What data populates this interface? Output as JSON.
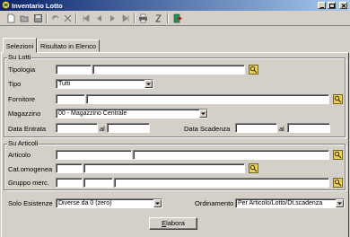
{
  "window": {
    "title": "Inventario Lotto"
  },
  "tabs": [
    {
      "label": "Selezioni"
    },
    {
      "label": "Risultato in Elenco"
    }
  ],
  "su_lotti": {
    "title": "Su Lotti",
    "tipologia_label": "Tipologia",
    "tipo_label": "Tipo",
    "tipo_value": "Tutti",
    "fornitore_label": "Fornitore",
    "magazzino_label": "Magazzino",
    "magazzino_value": "00 - Magazzino Centrale",
    "data_entrata_label": "Data Entrata",
    "al_label_1": "al",
    "data_scadenza_label": "Data Scadenza",
    "al_label_2": "al"
  },
  "su_articoli": {
    "title": "Su Articoli",
    "articolo_label": "Articolo",
    "cat_omogenea_label": "Cat.omogenea",
    "gruppo_merc_label": "Gruppo merc."
  },
  "footer": {
    "solo_esistenze_label": "Solo Esistenze",
    "solo_esistenze_value": "Diverse da 0 (zero)",
    "ordinamento_label": "Ordinamento",
    "ordinamento_value": "Per Articolo/Lotto/Dt.scadenza",
    "elabora_label": "Elabora"
  },
  "colors": {
    "title_bar": "#0a246a",
    "window_bg": "#d4d0c8",
    "lookup_icon": "#c8a000"
  }
}
